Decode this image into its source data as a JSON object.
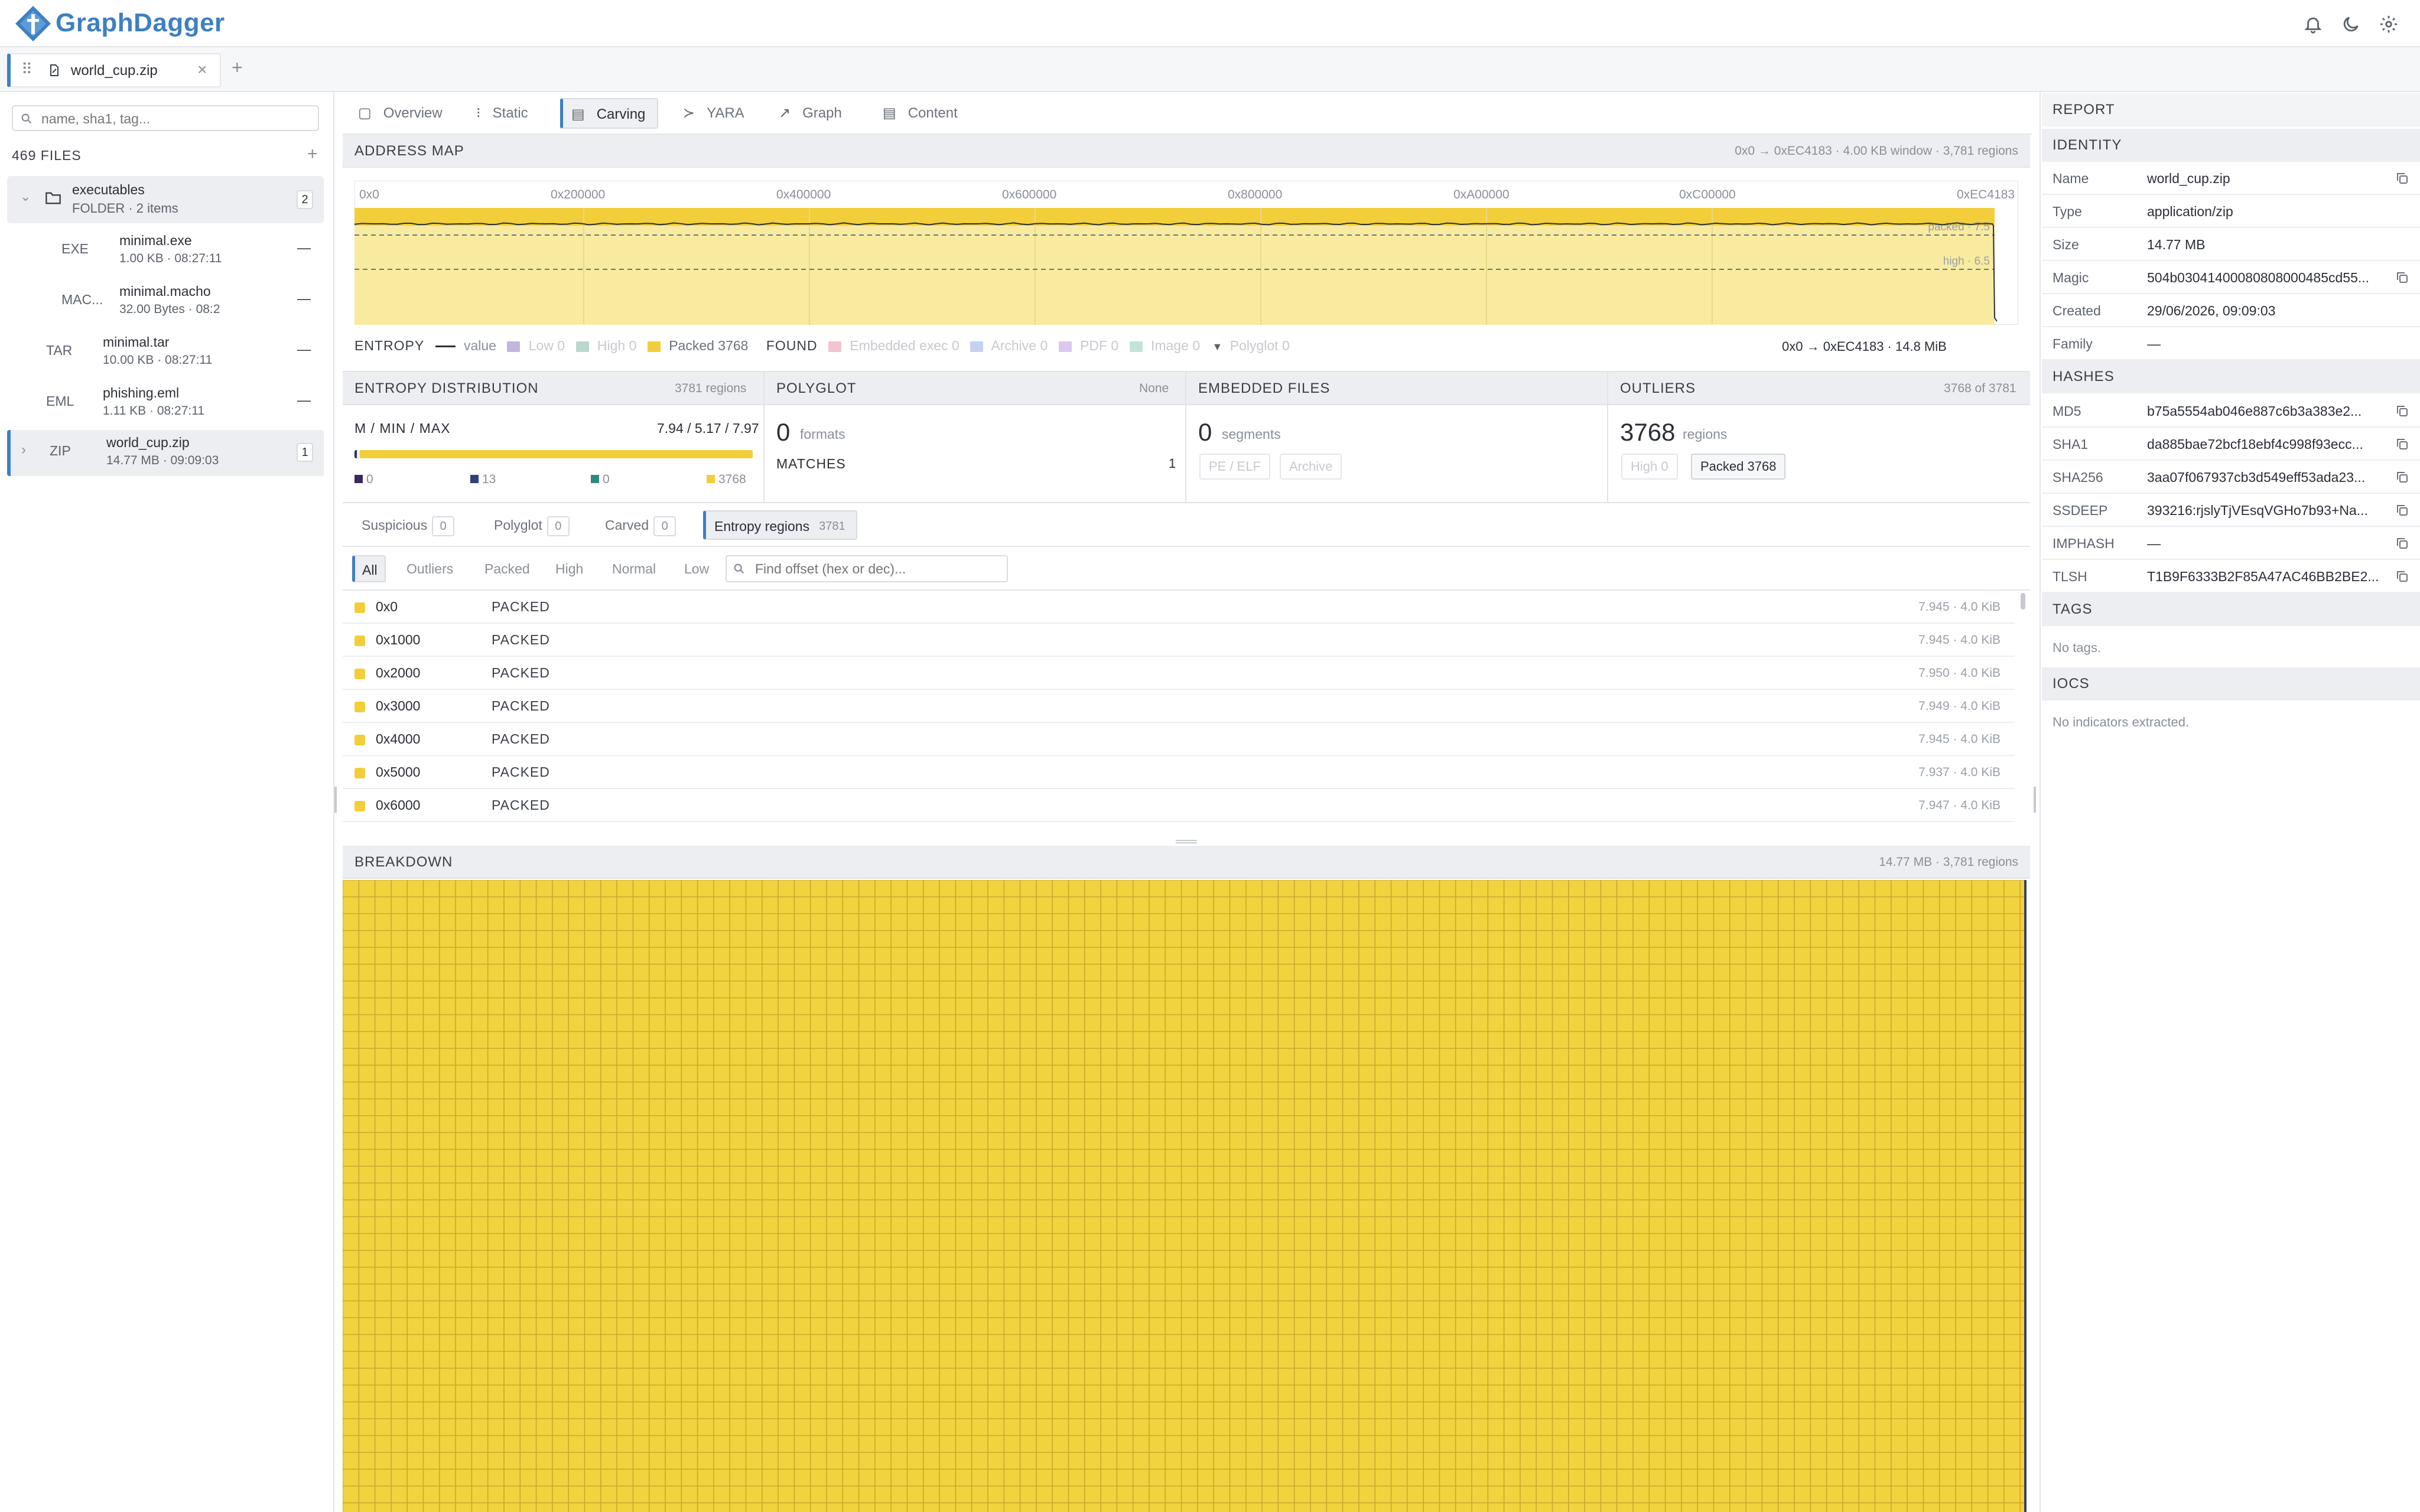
{
  "app": {
    "name": "GraphDagger"
  },
  "tab": {
    "filename": "world_cup.zip"
  },
  "sidebar": {
    "search_placeholder": "name, sha1, tag...",
    "count_label": "469 FILES",
    "folder": {
      "name": "executables",
      "meta": "FOLDER · 2 items",
      "badge": "2"
    },
    "items": [
      {
        "type": "EXE",
        "name": "minimal.exe",
        "meta": "1.00 KB · 08:27:11",
        "status": "—"
      },
      {
        "type": "MAC...",
        "name": "minimal.macho",
        "meta": "32.00 Bytes · 08:2",
        "status": "—"
      },
      {
        "type": "TAR",
        "name": "minimal.tar",
        "meta": "10.00 KB · 08:27:11",
        "status": "—"
      },
      {
        "type": "EML",
        "name": "phishing.eml",
        "meta": "1.11 KB · 08:27:11",
        "status": "—"
      },
      {
        "type": "ZIP",
        "name": "world_cup.zip",
        "meta": "14.77 MB · 09:09:03",
        "status": "1"
      }
    ]
  },
  "nav": {
    "tabs": [
      "Overview",
      "Static",
      "Carving",
      "YARA",
      "Graph",
      "Content"
    ],
    "active": "Carving"
  },
  "address_map": {
    "title": "ADDRESS MAP",
    "info": "0x0 → 0xEC4183 · 4.00 KB window · 3,781 regions",
    "ticks": [
      "0x0",
      "0x200000",
      "0x400000",
      "0x600000",
      "0x800000",
      "0xA00000",
      "0xC00000",
      "0xEC4183"
    ],
    "packed_label": "packed · 7.5",
    "high_label": "high · 6.5",
    "range_label": "0x0 → 0xEC4183 · 14.8 MiB",
    "entropy_legend": {
      "title": "ENTROPY",
      "value": "value",
      "low": "Low",
      "low_count": "0",
      "high": "High",
      "high_count": "0",
      "packed": "Packed",
      "packed_count": "3768"
    },
    "found_legend": {
      "title": "FOUND",
      "embedded": "Embedded exec",
      "embedded_count": "0",
      "archive": "Archive",
      "archive_count": "0",
      "pdf": "PDF",
      "pdf_count": "0",
      "image": "Image",
      "image_count": "0",
      "polyglot": "Polyglot",
      "polyglot_count": "0"
    }
  },
  "entropy_dist": {
    "title": "ENTROPY DISTRIBUTION",
    "regions": "3781 regions",
    "label": "M / MIN / MAX",
    "values": "7.94 / 5.17 / 7.97",
    "counts": [
      "0",
      "13",
      "0",
      "3768"
    ],
    "packed_fraction": 0.9966
  },
  "polyglot": {
    "title": "POLYGLOT",
    "right": "None",
    "count": "0",
    "unit": "formats",
    "matches_label": "MATCHES",
    "matches": "1"
  },
  "embedded": {
    "title": "EMBEDDED FILES",
    "count": "0",
    "unit": "segments",
    "chip1": "PE / ELF",
    "chip2": "Archive"
  },
  "outliers": {
    "title": "OUTLIERS",
    "right": "3768 of 3781",
    "count": "3768",
    "unit": "regions",
    "chip1": "High 0",
    "chip2": "Packed 3768"
  },
  "subtabs": [
    {
      "label": "Suspicious",
      "count": "0"
    },
    {
      "label": "Polyglot",
      "count": "0"
    },
    {
      "label": "Carved",
      "count": "0"
    },
    {
      "label": "Entropy regions",
      "count": "3781"
    }
  ],
  "filters": {
    "items": [
      "All",
      "Outliers",
      "Packed",
      "High",
      "Normal",
      "Low"
    ],
    "active": "All",
    "search_placeholder": "Find offset (hex or dec)..."
  },
  "regions": [
    {
      "offset": "0x0",
      "kind": "PACKED",
      "meta": "7.945 · 4.0 KiB"
    },
    {
      "offset": "0x1000",
      "kind": "PACKED",
      "meta": "7.945 · 4.0 KiB"
    },
    {
      "offset": "0x2000",
      "kind": "PACKED",
      "meta": "7.950 · 4.0 KiB"
    },
    {
      "offset": "0x3000",
      "kind": "PACKED",
      "meta": "7.949 · 4.0 KiB"
    },
    {
      "offset": "0x4000",
      "kind": "PACKED",
      "meta": "7.945 · 4.0 KiB"
    },
    {
      "offset": "0x5000",
      "kind": "PACKED",
      "meta": "7.937 · 4.0 KiB"
    },
    {
      "offset": "0x6000",
      "kind": "PACKED",
      "meta": "7.947 · 4.0 KiB"
    }
  ],
  "breakdown": {
    "title": "BREAKDOWN",
    "info": "14.77 MB · 3,781 regions"
  },
  "report": {
    "title": "REPORT",
    "identity_title": "IDENTITY",
    "identity": [
      {
        "k": "Name",
        "v": "world_cup.zip",
        "copy": true
      },
      {
        "k": "Type",
        "v": "application/zip",
        "copy": false
      },
      {
        "k": "Size",
        "v": "14.77 MB",
        "copy": false
      },
      {
        "k": "Magic",
        "v": "504b03041400080808000485cd55...",
        "copy": true
      },
      {
        "k": "Created",
        "v": "29/06/2026, 09:09:03",
        "copy": false
      },
      {
        "k": "Family",
        "v": "—",
        "copy": false
      }
    ],
    "hashes_title": "HASHES",
    "hashes": [
      {
        "k": "MD5",
        "v": "b75a5554ab046e887c6b3a383e2..."
      },
      {
        "k": "SHA1",
        "v": "da885bae72bcf18ebf4c998f93ecc..."
      },
      {
        "k": "SHA256",
        "v": "3aa07f067937cb3d549eff53ada23..."
      },
      {
        "k": "SSDEEP",
        "v": "393216:rjslyTjVEsqVGHo7b93+Na..."
      },
      {
        "k": "IMPHASH",
        "v": "—"
      },
      {
        "k": "TLSH",
        "v": "T1B9F6333B2F85A47AC46BB2BE2..."
      }
    ],
    "tags_title": "TAGS",
    "tags_empty": "No tags.",
    "iocs_title": "IOCS",
    "iocs_empty": "No indicators extracted."
  },
  "colors": {
    "accent": "#3d7fc4",
    "packed": "#f2cf3a",
    "packed_light": "#f8eba0",
    "grid": "#c9a92a"
  }
}
